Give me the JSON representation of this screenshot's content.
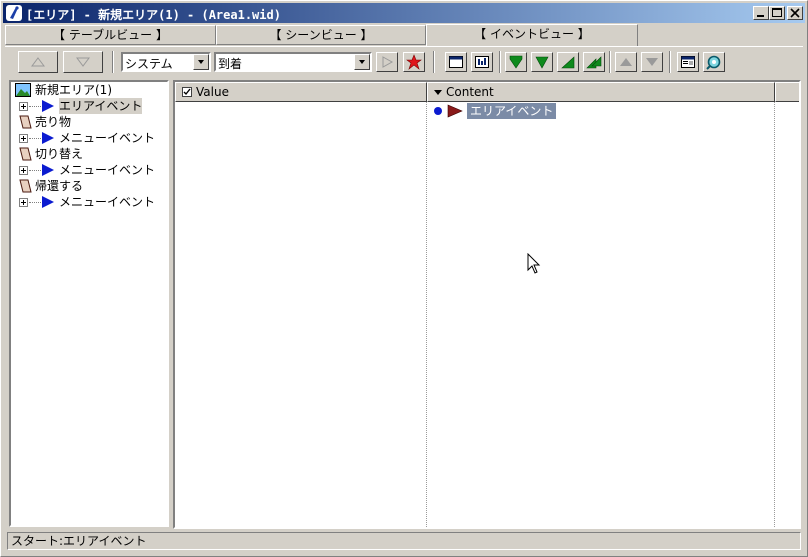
{
  "window": {
    "title": "[エリア] - 新規エリア(1) - (Area1.wid)"
  },
  "tabs": [
    {
      "label": "【 テーブルビュー 】",
      "active": false
    },
    {
      "label": "【 シーンビュー 】",
      "active": false
    },
    {
      "label": "【 イベントビュー 】",
      "active": true
    }
  ],
  "toolbar": {
    "system_combo": "システム",
    "trigger_combo": "到着"
  },
  "tree": {
    "root": "新規エリア(1)",
    "items": [
      {
        "label": "エリアイベント",
        "level": 1
      },
      {
        "label": "売り物",
        "level": 0
      },
      {
        "label": "メニューイベント",
        "level": 1
      },
      {
        "label": "切り替え",
        "level": 0
      },
      {
        "label": "メニューイベント",
        "level": 1
      },
      {
        "label": "帰還する",
        "level": 0
      },
      {
        "label": "メニューイベント",
        "level": 1
      }
    ]
  },
  "table": {
    "value_header": "Value",
    "content_header": "Content",
    "content_item": "エリアイベント"
  },
  "status": {
    "text": "スタート:エリアイベント"
  },
  "colors": {
    "titlebar_start": "#0a246a",
    "titlebar_end": "#a6caf0",
    "selection": "#7b8ba6"
  }
}
